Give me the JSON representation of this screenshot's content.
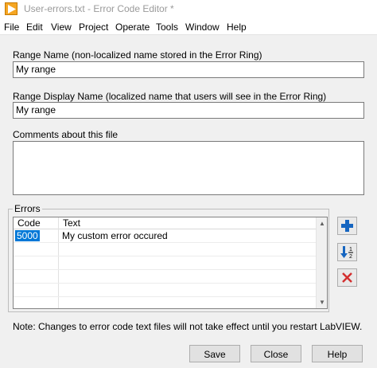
{
  "window": {
    "title": "User-errors.txt - Error Code Editor *"
  },
  "menu": [
    "File",
    "Edit",
    "View",
    "Project",
    "Operate",
    "Tools",
    "Window",
    "Help"
  ],
  "range_name": {
    "label": "Range Name (non-localized name stored in the Error Ring)",
    "value": "My range"
  },
  "range_display_name": {
    "label": "Range Display Name (localized name that users will see in the Error Ring)",
    "value": "My range"
  },
  "comments": {
    "label": "Comments about this file",
    "value": ""
  },
  "errors": {
    "group_title": "Errors",
    "columns": [
      "Code",
      "Text"
    ],
    "rows": [
      {
        "code": "5000",
        "text": "My custom error occured"
      }
    ]
  },
  "side_buttons": {
    "add": "add-icon",
    "sort": "sort-ascending-icon",
    "delete": "delete-icon"
  },
  "note": "Note: Changes to error code text files will not take effect until you restart LabVIEW.",
  "buttons": {
    "save": "Save",
    "close": "Close",
    "help": "Help"
  }
}
